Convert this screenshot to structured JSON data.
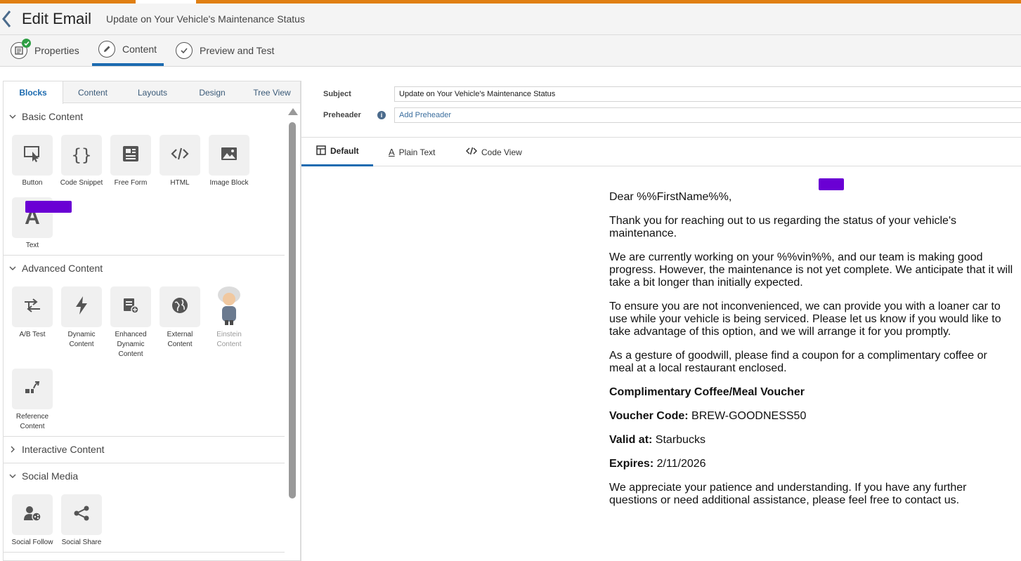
{
  "header": {
    "title": "Edit Email",
    "subtitle": "Update on Your Vehicle's Maintenance Status"
  },
  "steps": [
    {
      "label": "Properties"
    },
    {
      "label": "Content"
    },
    {
      "label": "Preview and Test"
    }
  ],
  "left_tabs": [
    "Blocks",
    "Content",
    "Layouts",
    "Design",
    "Tree View"
  ],
  "sections": {
    "basic": {
      "title": "Basic Content",
      "blocks": [
        "Button",
        "Code Snippet",
        "Free Form",
        "HTML",
        "Image Block",
        "Text"
      ]
    },
    "advanced": {
      "title": "Advanced Content",
      "blocks": [
        {
          "l1": "A/B Test",
          "l2": "",
          "l3": ""
        },
        {
          "l1": "Dynamic",
          "l2": "Content",
          "l3": ""
        },
        {
          "l1": "Enhanced",
          "l2": "Dynamic",
          "l3": "Content"
        },
        {
          "l1": "External",
          "l2": "Content",
          "l3": ""
        },
        {
          "l1": "Einstein",
          "l2": "Content",
          "l3": ""
        },
        {
          "l1": "Reference",
          "l2": "Content",
          "l3": ""
        }
      ]
    },
    "interactive": {
      "title": "Interactive Content"
    },
    "social": {
      "title": "Social Media",
      "blocks": [
        "Social Follow",
        "Social Share"
      ]
    }
  },
  "fields": {
    "subject_label": "Subject",
    "subject_value": "Update on Your Vehicle's Maintenance Status",
    "preheader_label": "Preheader",
    "preheader_placeholder": "Add Preheader"
  },
  "view_tabs": [
    "Default",
    "Plain Text",
    "Code View"
  ],
  "email": {
    "greeting": "Dear %%FirstName%%,",
    "p1": "Thank you for reaching out to us regarding the status of your vehicle's maintenance.",
    "p2": "We are currently working on your %%vin%%, and our team is making good progress. However, the maintenance is not yet complete. We anticipate that it will take a bit longer than initially expected.",
    "p3": "To ensure you are not inconvenienced, we can provide you with a loaner car to use while your vehicle is being serviced. Please let us know if you would like to take advantage of this option, and we will arrange it for you promptly.",
    "p4": "As a gesture of goodwill, please find a coupon for a complimentary coffee or meal at a local restaurant enclosed.",
    "voucher_title": "Complimentary Coffee/Meal Voucher",
    "code_label": "Voucher Code:",
    "code_value": " BREW-GOODNESS50",
    "valid_label": "Valid at:",
    "valid_value": " Starbucks",
    "expires_label": "Expires:",
    "expires_value": " 2/11/2026",
    "p5": "We appreciate your patience and understanding. If you have any further questions or need additional assistance, please feel free to contact us."
  },
  "colors": {
    "accent": "#1c6bb0",
    "progress": "#e07f12",
    "redaction": "#6a00d4",
    "success": "#2e9e44"
  }
}
